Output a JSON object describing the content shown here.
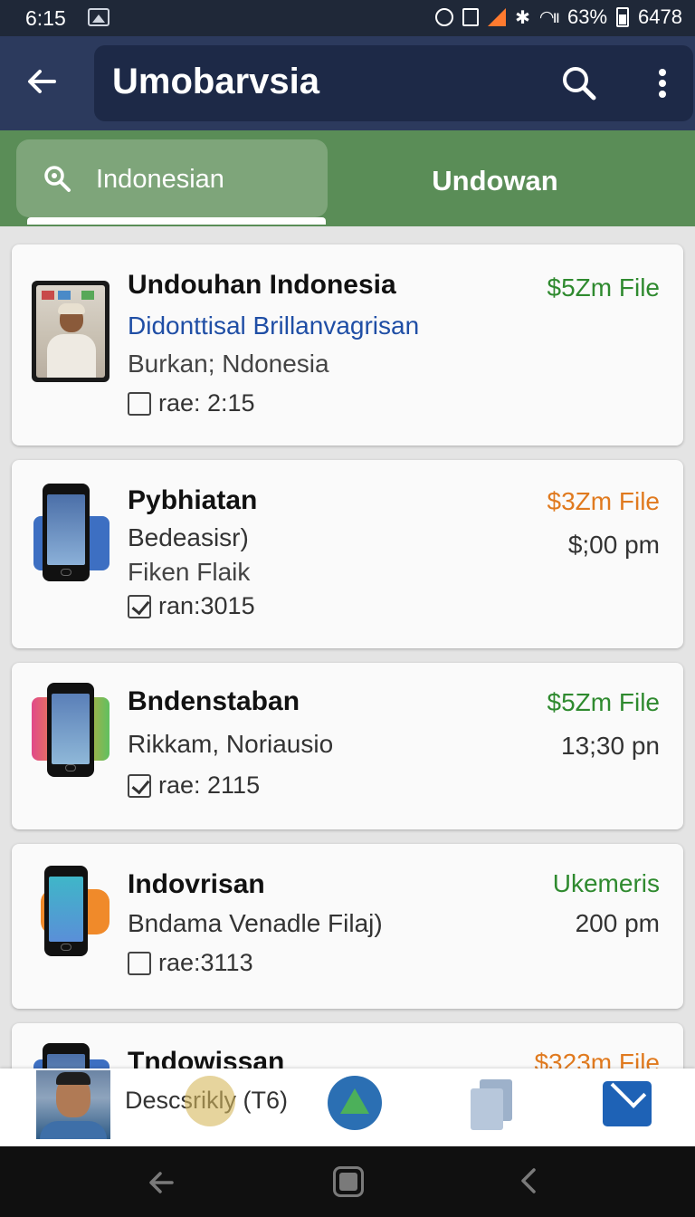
{
  "status_bar": {
    "time": "6:15",
    "battery_percent": "63%",
    "extra": "6478"
  },
  "app_bar": {
    "title": "Umobarvsia",
    "icons": [
      "back-arrow-icon",
      "search-icon",
      "more-vert-icon"
    ]
  },
  "tabs": [
    {
      "label": "Indonesian",
      "active": true,
      "icon": "search-icon"
    },
    {
      "label": "Undowan",
      "active": false
    }
  ],
  "items": [
    {
      "name": "Undouhan Indonesia",
      "subtitle": "Didonttisal Brillanvagrisan",
      "subtitle_is_link": true,
      "location": "Burkan; Ndonesia",
      "meta": "rae: 2:15",
      "checked": false,
      "price": "$5Zm File",
      "price_color": "#2f8a2f",
      "time": "",
      "thumb": "photo"
    },
    {
      "name": "Pybhiatan",
      "subtitle": "Bedeasisr)",
      "subtitle_is_link": false,
      "location": "Fiken Flaik",
      "meta": "ran:3015",
      "checked": true,
      "price": "$3Zm File",
      "price_color": "#e07a1f",
      "time": "$;00 pm",
      "thumb": "phone-blue"
    },
    {
      "name": "Bndenstaban",
      "subtitle": "Rikkam, Noriausio",
      "subtitle_is_link": false,
      "location": "",
      "meta": "rae: 2115",
      "checked": true,
      "price": "$5Zm File",
      "price_color": "#2f8a2f",
      "time": "13;30 pn",
      "thumb": "phone-colorful"
    },
    {
      "name": "Indovrisan",
      "subtitle": "Bndama Venadle Filaj)",
      "subtitle_is_link": false,
      "location": "",
      "meta": "rae:3113",
      "checked": false,
      "price": "Ukemeris",
      "price_color": "#2f8a2f",
      "time": "200 pm",
      "thumb": "phone-orange"
    },
    {
      "name": "Tndowissan",
      "price": "$323m File",
      "price_color": "#e07a1f",
      "thumb": "phone-blue"
    }
  ],
  "bottom_bar": {
    "label": "Descsrikly (T6)",
    "icons": [
      "avatar",
      "coin-icon",
      "drive-icon",
      "copy-icon",
      "mail-icon"
    ]
  },
  "system_nav": {
    "icons": [
      "back-icon",
      "home-icon",
      "recents-icon"
    ]
  }
}
